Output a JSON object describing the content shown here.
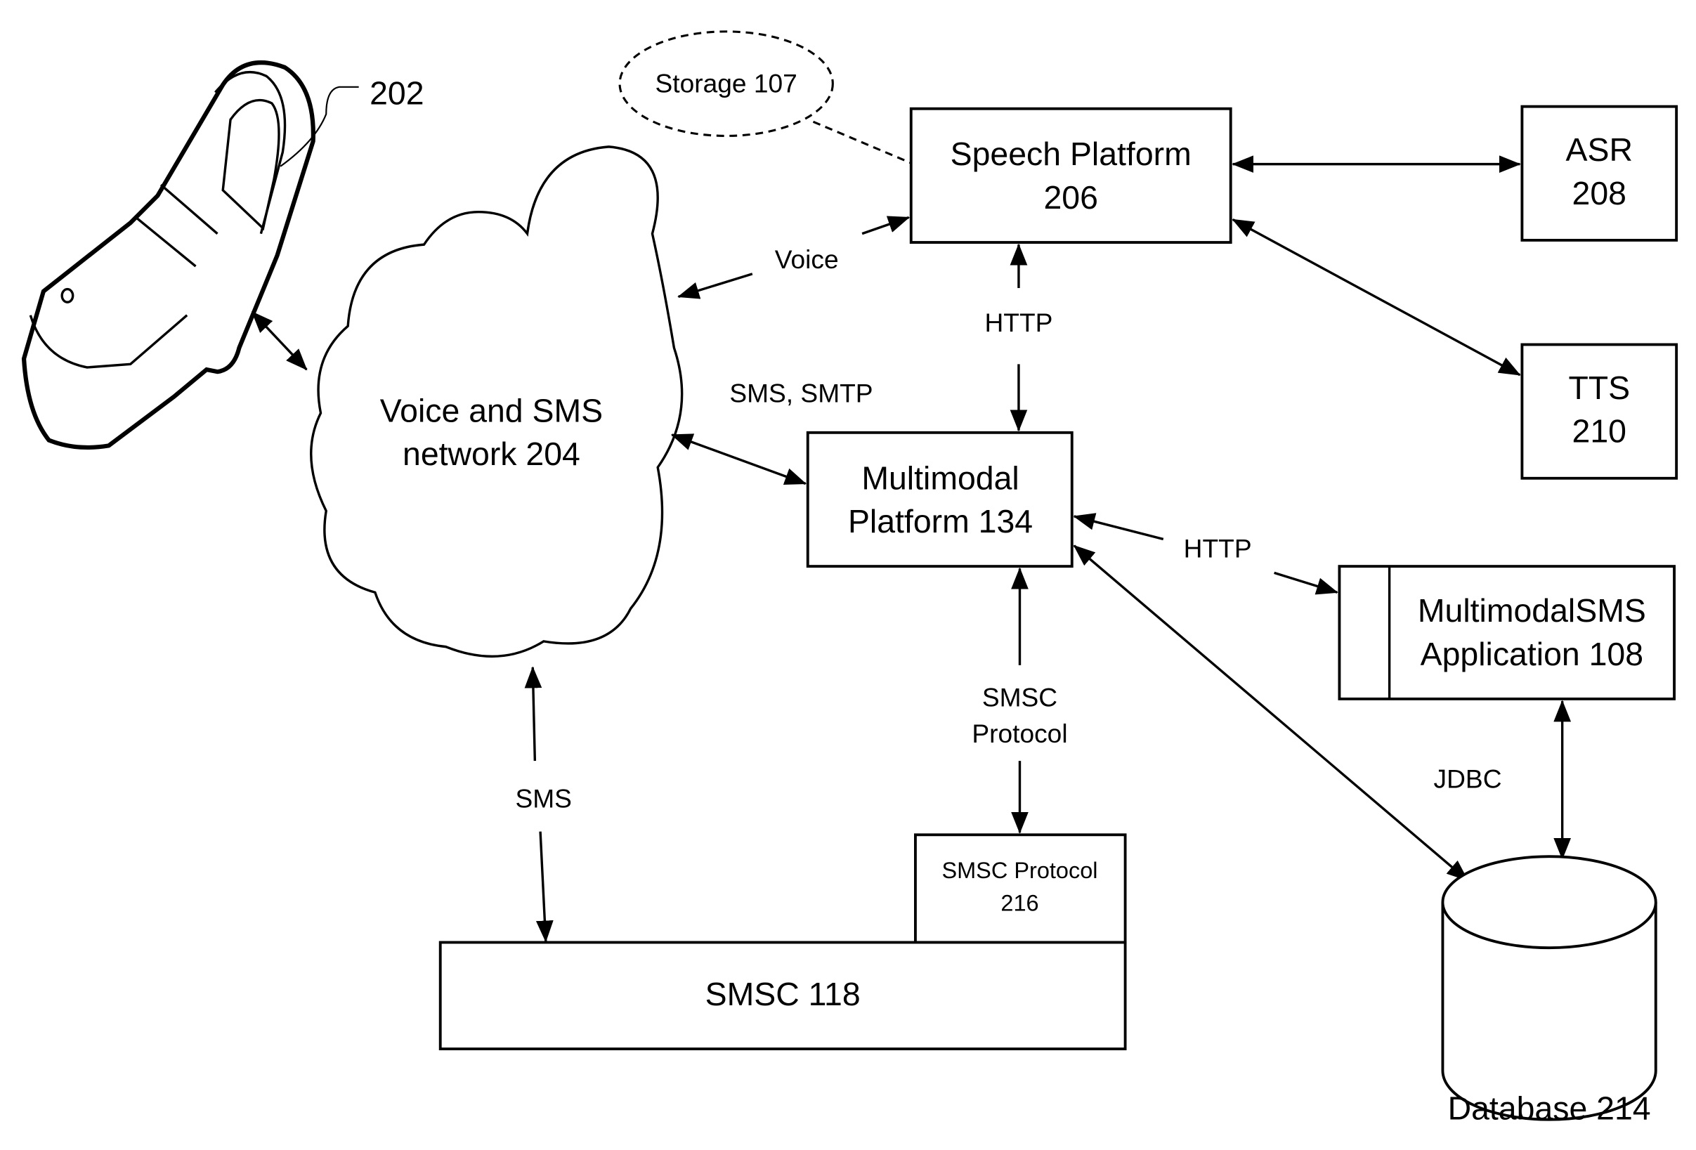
{
  "diagram": {
    "phone": {
      "label": "202",
      "icon": "mobile-phone-icon"
    },
    "storage": {
      "label": "Storage 107"
    },
    "speech_platform": {
      "line1": "Speech Platform",
      "line2": "206"
    },
    "asr": {
      "line1": "ASR",
      "line2": "208"
    },
    "tts": {
      "line1": "TTS",
      "line2": "210"
    },
    "network": {
      "line1": "Voice and SMS",
      "line2": "network 204"
    },
    "multimodal_platform": {
      "line1": "Multimodal",
      "line2": "Platform 134"
    },
    "multimodal_app": {
      "line1": "MultimodalSMS",
      "line2": "Application 108"
    },
    "smsc_protocol_box": {
      "line1": "SMSC Protocol",
      "line2": "216"
    },
    "smsc": {
      "label": "SMSC 118"
    },
    "database": {
      "label": "Database 214"
    },
    "edges": {
      "voice": "Voice",
      "http_speech": "HTTP",
      "sms_smtp": "SMS, SMTP",
      "http_app": "HTTP",
      "smsc_protocol_line1": "SMSC",
      "smsc_protocol_line2": "Protocol",
      "sms": "SMS",
      "jdbc": "JDBC"
    }
  }
}
